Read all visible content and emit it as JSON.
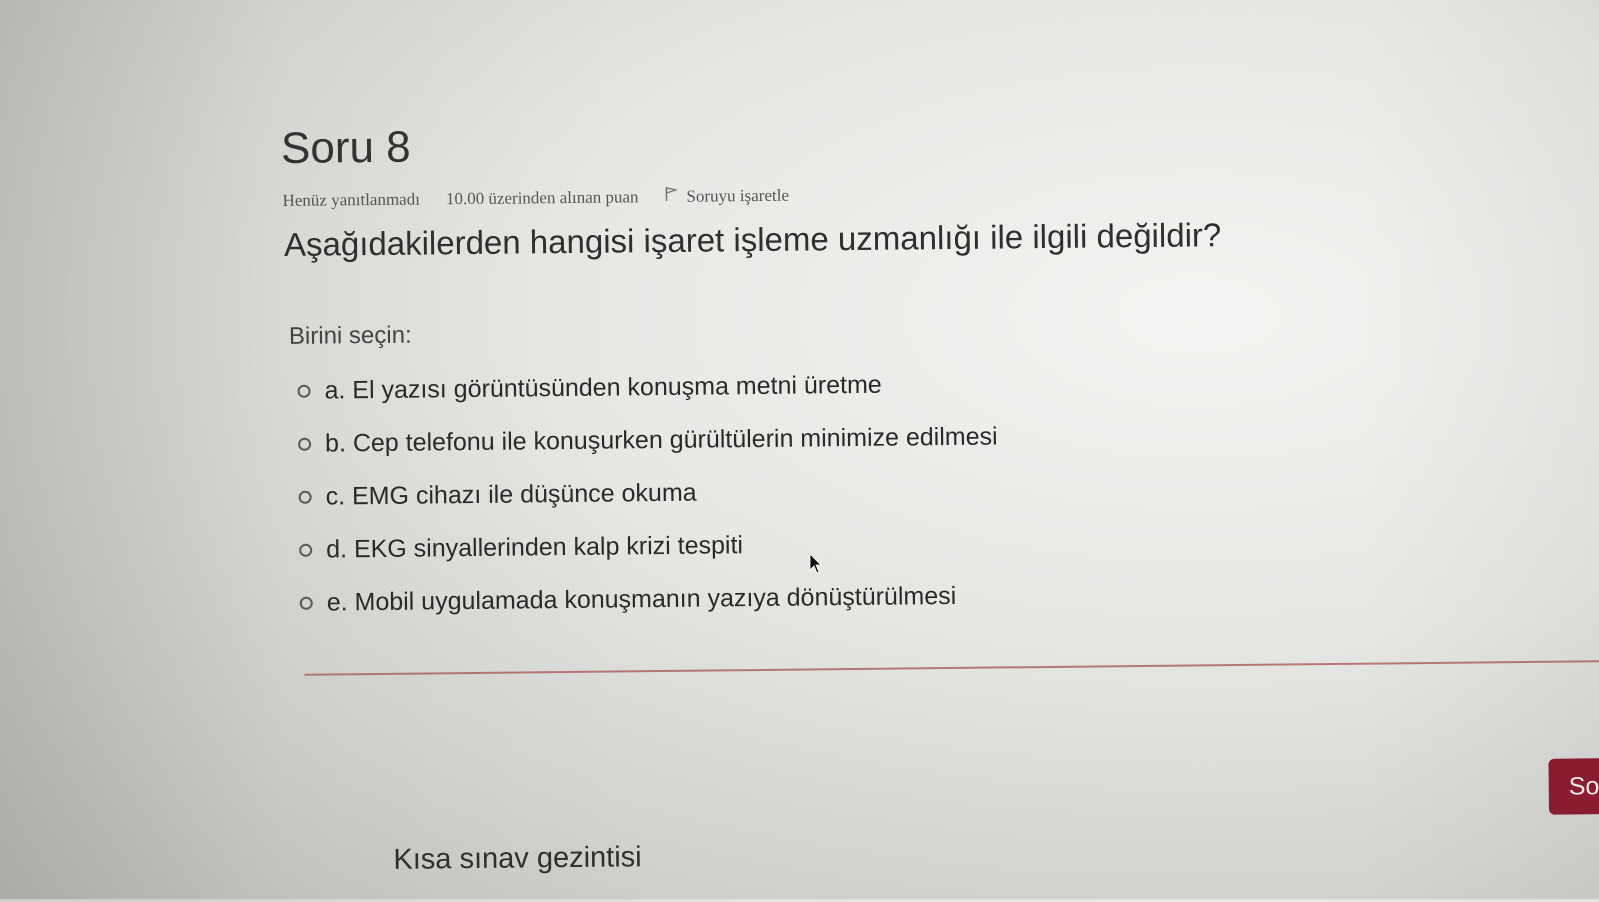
{
  "question": {
    "title": "Soru 8",
    "status": "Henüz yanıtlanmadı",
    "mark": "10.00 üzerinden alınan puan",
    "flag_label": "Soruyu işaretle",
    "text": "Aşağıdakilerden hangisi işaret işleme uzmanlığı ile ilgili değildir?",
    "prompt": "Birini seçin:",
    "answers": [
      "a. El yazısı görüntüsünden konuşma metni üretme",
      "b. Cep telefonu ile konuşurken gürültülerin minimize edilmesi",
      "c. EMG cihazı ile düşünce okuma",
      "d. EKG sinyallerinden kalp krizi tespiti",
      "e. Mobil uygulamada konuşmanın yazıya dönüştürülmesi"
    ]
  },
  "footer": {
    "next_button_label": "Sor",
    "navigation_title": "Kısa sınav gezintisi"
  },
  "colors": {
    "accent": "#8a1c32",
    "divider": "#a95d5d"
  },
  "icons": {
    "flag": "flag-icon",
    "radio": "radio-unchecked-icon",
    "cursor": "mouse-pointer-icon"
  }
}
